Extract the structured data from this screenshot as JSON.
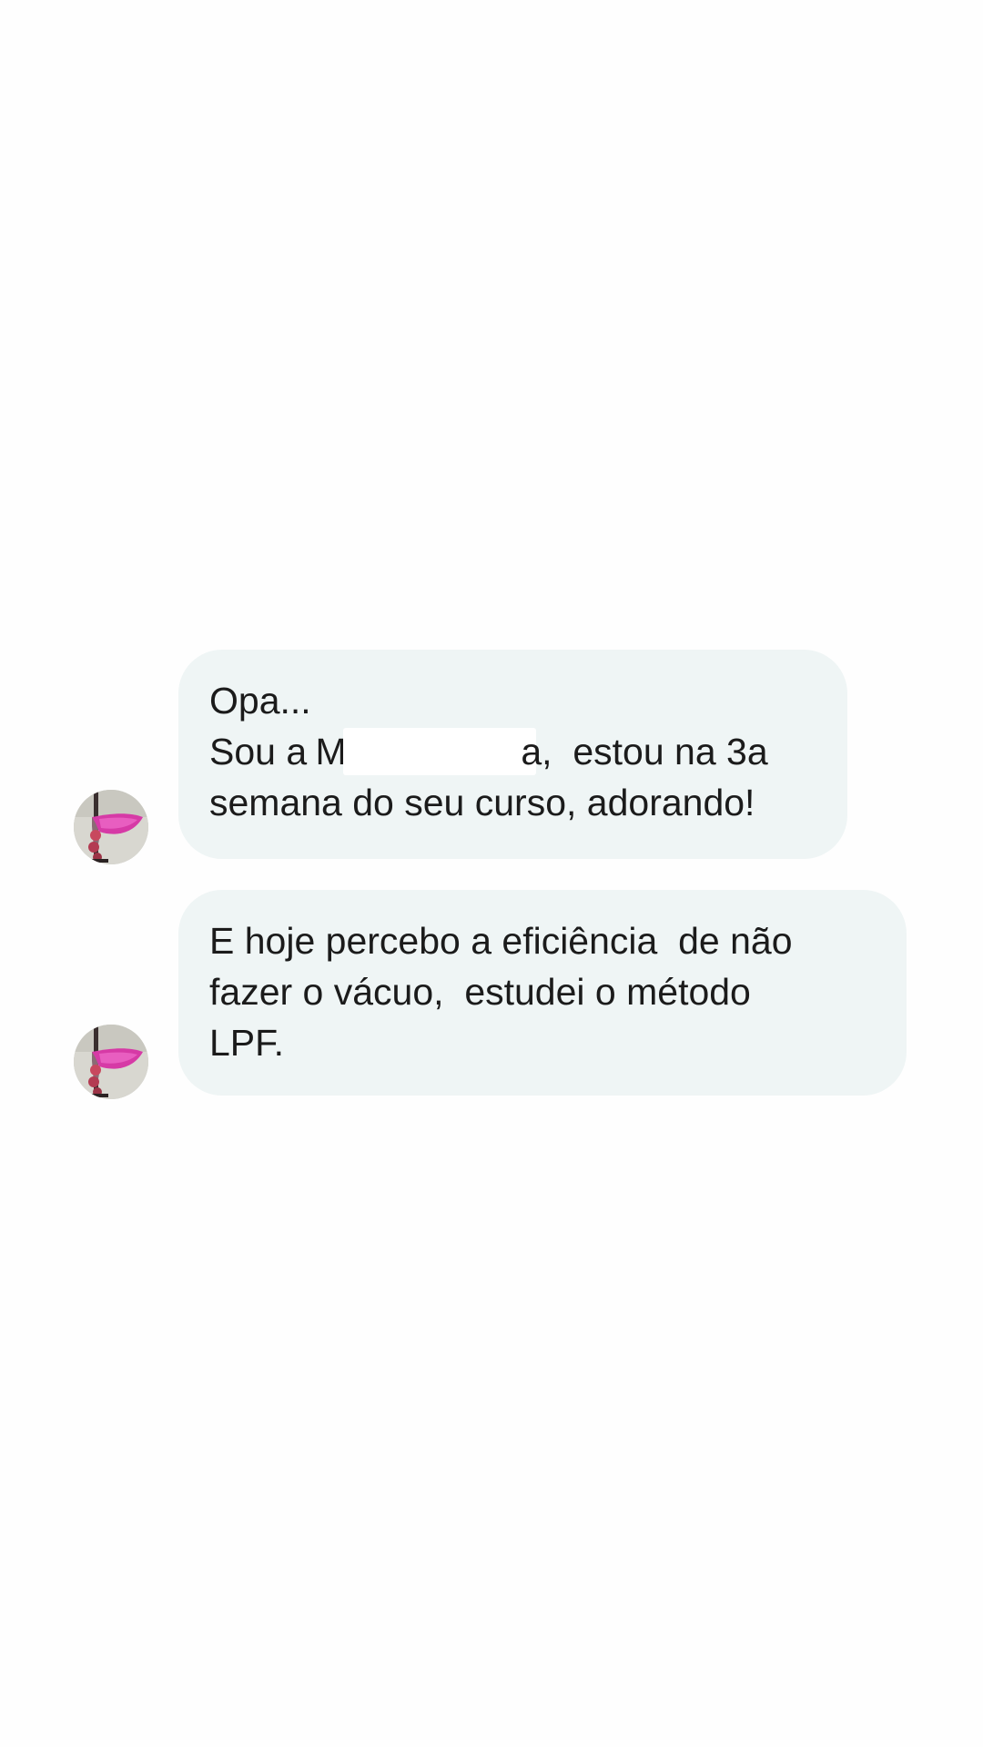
{
  "conversation": {
    "messages": [
      {
        "sender_avatar": "pole-dance-avatar-icon",
        "lines": {
          "line1": "Opa...",
          "line2_prefix": "Sou a ",
          "line2_redacted_start": "M",
          "line2_redacted_end": "a,",
          "line2_suffix": "  estou na 3a",
          "line3": "semana do seu curso, adorando!"
        }
      },
      {
        "sender_avatar": "pole-dance-avatar-icon",
        "lines": {
          "line1": "E hoje percebo a eficiência  de não",
          "line2": "fazer o vácuo,  estudei o método",
          "line3": "LPF."
        }
      }
    ]
  },
  "colors": {
    "background": "#fefefe",
    "bubble": "#eff5f5",
    "text": "#1b1b1b",
    "avatar_accent": "#d63aa6"
  }
}
